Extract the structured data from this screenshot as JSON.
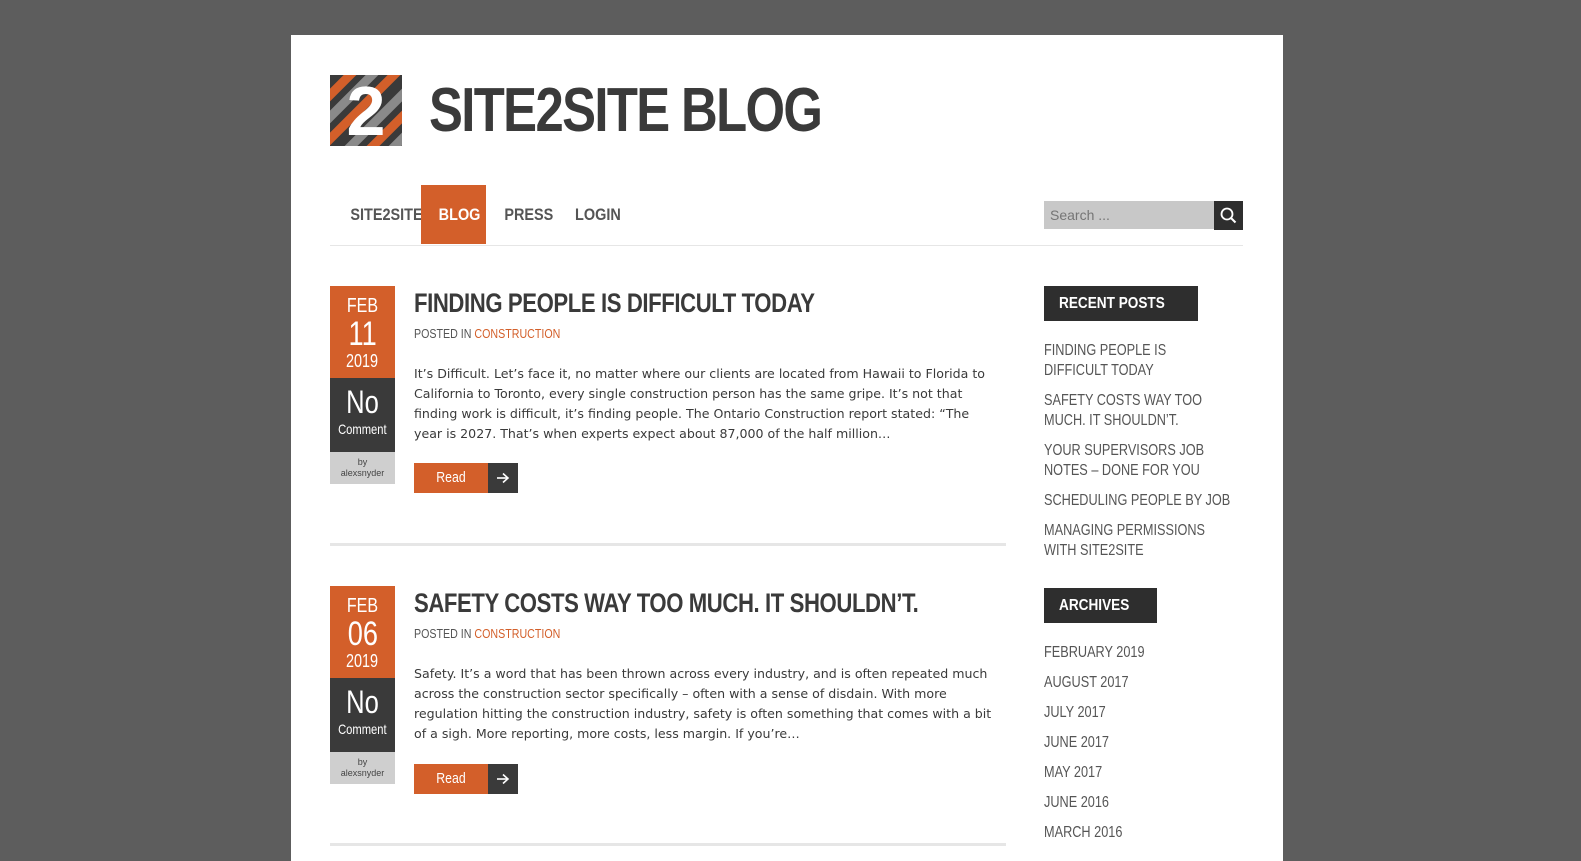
{
  "site": {
    "title": "SITE2SITE BLOG",
    "logo_glyph": "2",
    "brand_color": "#d35f2a",
    "dark_color": "#3a3a3a"
  },
  "nav": {
    "items": [
      {
        "label": "SITE2SITE",
        "active": false
      },
      {
        "label": "BLOG",
        "active": true
      },
      {
        "label": "PRESS",
        "active": false
      },
      {
        "label": "LOGIN",
        "active": false
      }
    ],
    "search_placeholder": "Search ..."
  },
  "posts": [
    {
      "month": "FEB",
      "day": "11",
      "year": "2019",
      "comments_count": "No",
      "comments_label": "Comment",
      "by_label": "by",
      "author": "alexsnyder",
      "title": "FINDING PEOPLE IS DIFFICULT TODAY",
      "posted_in_label": "POSTED IN",
      "category": "CONSTRUCTION",
      "excerpt": "It’s Difficult. Let’s face it, no matter where our clients are located from Hawaii to Florida to California to Toronto, every single construction person has the same gripe. It’s not that finding work is difficult, it’s finding people. The Ontario Construction report stated:  “The year is 2027. That’s when experts expect about 87,000 of the half million…",
      "read_more": "Read More"
    },
    {
      "month": "FEB",
      "day": "06",
      "year": "2019",
      "comments_count": "No",
      "comments_label": "Comment",
      "by_label": "by",
      "author": "alexsnyder",
      "title": "SAFETY COSTS WAY TOO MUCH. IT SHOULDN’T.",
      "posted_in_label": "POSTED IN",
      "category": "CONSTRUCTION",
      "excerpt": "Safety. It’s a word that has been thrown across every industry, and is often repeated much across the construction sector specifically – often with a sense of disdain. With more regulation hitting the construction industry, safety is often something that comes with a bit of a sigh. More reporting, more costs, less margin. If you’re…",
      "read_more": "Read More"
    }
  ],
  "sidebar": {
    "recent_posts_title": "RECENT POSTS",
    "recent_posts": [
      "FINDING PEOPLE IS DIFFICULT TODAY",
      "SAFETY COSTS WAY TOO MUCH. IT SHOULDN’T.",
      "YOUR SUPERVISORS JOB NOTES – DONE FOR YOU",
      "SCHEDULING PEOPLE BY JOB",
      "MANAGING PERMISSIONS WITH SITE2SITE"
    ],
    "archives_title": "ARCHIVES",
    "archives": [
      "FEBRUARY 2019",
      "AUGUST 2017",
      "JULY 2017",
      "JUNE 2017",
      "MAY 2017",
      "JUNE 2016",
      "MARCH 2016"
    ]
  },
  "icons": {
    "search": "search-icon",
    "read_more_arrow": "arrow-right-icon"
  }
}
